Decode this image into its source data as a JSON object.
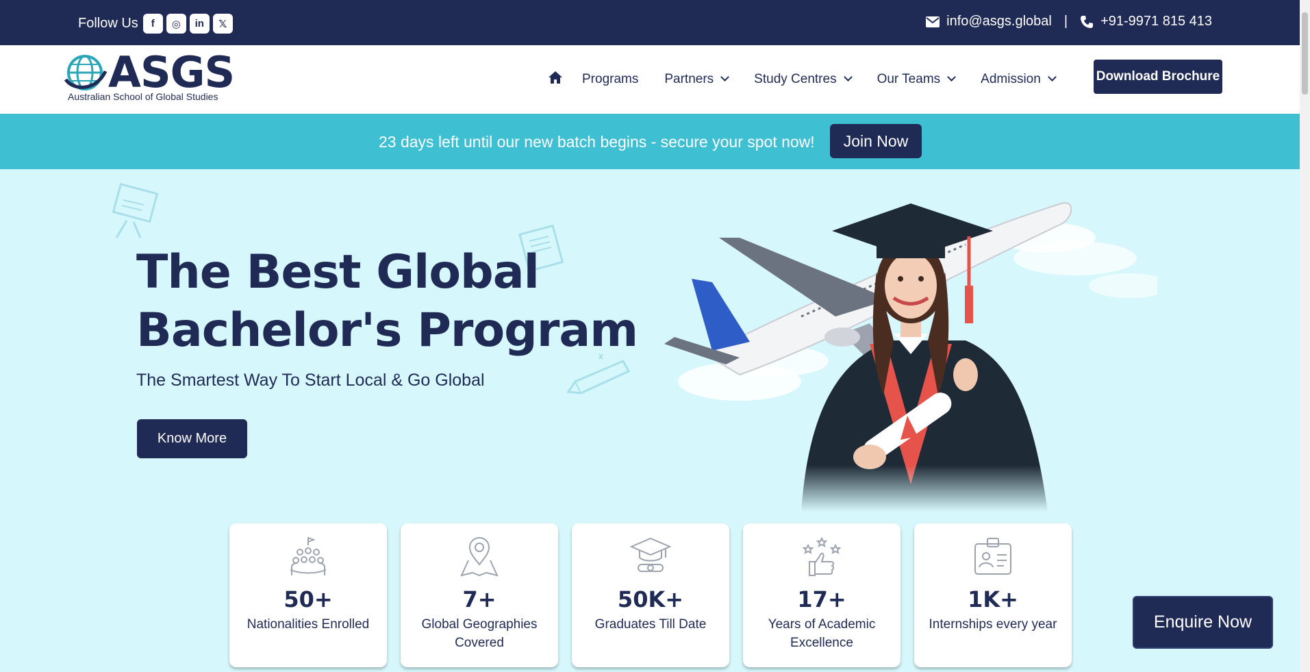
{
  "topbar": {
    "follow_label": "Follow Us",
    "social": [
      {
        "name": "facebook-icon",
        "glyph": "f"
      },
      {
        "name": "instagram-icon",
        "glyph": "◎"
      },
      {
        "name": "linkedin-icon",
        "glyph": "in"
      },
      {
        "name": "x-icon",
        "glyph": "𝕏"
      }
    ],
    "email": "info@asgs.global",
    "separator": "|",
    "phone": "+91-9971 815 413"
  },
  "header": {
    "logo_text": "ASGS",
    "logo_subtitle": "Australian School of Global Studies",
    "nav": {
      "programs": "Programs",
      "partners": "Partners",
      "study_centres": "Study Centres",
      "our_teams": "Our Teams",
      "admission": "Admission"
    },
    "brochure_button": "Download Brochure"
  },
  "banner": {
    "text": "23 days left until our new batch begins - secure your spot now!",
    "join_button": "Join Now"
  },
  "hero": {
    "title_line1": "The Best Global",
    "title_line2": "Bachelor's Program",
    "subtitle": "The Smartest Way To Start Local & Go Global",
    "know_more_button": "Know More"
  },
  "stats": [
    {
      "icon": "crowd-icon",
      "value": "50+",
      "label": "Nationalities Enrolled"
    },
    {
      "icon": "map-pin-icon",
      "value": "7+",
      "label": "Global Geographies Covered"
    },
    {
      "icon": "graduation-cap-icon",
      "value": "50K+",
      "label": "Graduates Till Date"
    },
    {
      "icon": "thumbs-up-stars-icon",
      "value": "17+",
      "label": "Years of Academic Excellence"
    },
    {
      "icon": "id-badge-icon",
      "value": "1K+",
      "label": "Internships every year"
    }
  ],
  "enquire_button": "Enquire Now",
  "colors": {
    "navy": "#1f2a55",
    "banner_teal": "#3fbfd2",
    "hero_bg": "#d6f7fc",
    "white": "#ffffff"
  }
}
